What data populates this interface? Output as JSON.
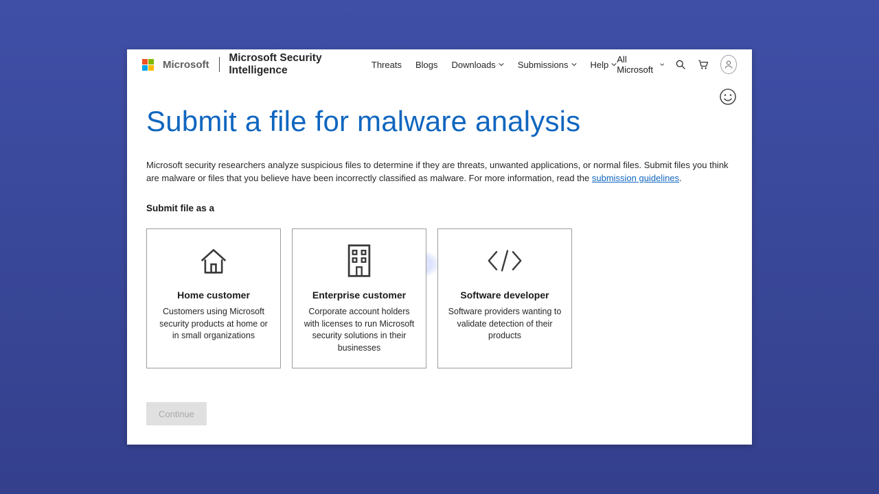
{
  "nav": {
    "brand": "Microsoft",
    "product": "Microsoft Security Intelligence",
    "items": [
      {
        "label": "Threats",
        "dropdown": false
      },
      {
        "label": "Blogs",
        "dropdown": false
      },
      {
        "label": "Downloads",
        "dropdown": true
      },
      {
        "label": "Submissions",
        "dropdown": true
      },
      {
        "label": "Help",
        "dropdown": true
      }
    ],
    "all_ms": "All Microsoft"
  },
  "page": {
    "title": "Submit a file for malware analysis",
    "intro_pre": "Microsoft security researchers analyze suspicious files to determine if they are threats, unwanted applications, or normal files. Submit files you think are malware or files that you believe have been incorrectly classified as malware. For more information, read the ",
    "intro_link": "submission guidelines",
    "intro_post": ".",
    "subheading": "Submit file as a",
    "continue": "Continue"
  },
  "cards": [
    {
      "title": "Home customer",
      "desc": "Customers using Microsoft security products at home or in small organizations"
    },
    {
      "title": "Enterprise customer",
      "desc": "Corporate account holders with licenses to run Microsoft security solutions in their businesses"
    },
    {
      "title": "Software developer",
      "desc": "Software providers wanting to validate detection of their products"
    }
  ]
}
